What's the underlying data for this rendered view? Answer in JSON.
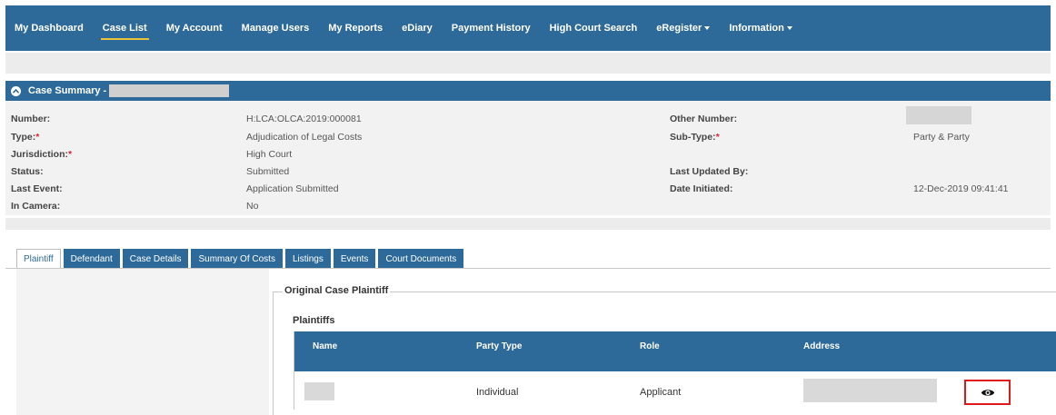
{
  "nav": {
    "items": [
      {
        "label": "My Dashboard",
        "active": false,
        "dropdown": false
      },
      {
        "label": "Case List",
        "active": true,
        "dropdown": false
      },
      {
        "label": "My Account",
        "active": false,
        "dropdown": false
      },
      {
        "label": "Manage Users",
        "active": false,
        "dropdown": false
      },
      {
        "label": "My Reports",
        "active": false,
        "dropdown": false
      },
      {
        "label": "eDiary",
        "active": false,
        "dropdown": false
      },
      {
        "label": "Payment History",
        "active": false,
        "dropdown": false
      },
      {
        "label": "High Court Search",
        "active": false,
        "dropdown": false
      },
      {
        "label": "eRegister",
        "active": false,
        "dropdown": true
      },
      {
        "label": "Information",
        "active": false,
        "dropdown": true
      }
    ]
  },
  "summary": {
    "title": "Case Summary -",
    "toggle_icon": "chevron-up-icon",
    "number_label": "Number:",
    "number_value": "H:LCA:OLCA:2019:000081",
    "other_number_label": "Other Number:",
    "type_label": "Type:",
    "type_value": "Adjudication of Legal Costs",
    "subtype_label": "Sub-Type:",
    "subtype_value": "Party & Party",
    "jurisdiction_label": "Jurisdiction:",
    "jurisdiction_value": "High Court",
    "status_label": "Status:",
    "status_value": "Submitted",
    "last_updated_label": "Last Updated By:",
    "last_event_label": "Last Event:",
    "last_event_value": "Application Submitted",
    "date_initiated_label": "Date Initiated:",
    "date_initiated_value": "12-Dec-2019 09:41:41",
    "in_camera_label": "In Camera:",
    "in_camera_value": "No",
    "required_mark": "*"
  },
  "tabs": [
    {
      "label": "Plaintiff",
      "active": true
    },
    {
      "label": "Defendant",
      "active": false
    },
    {
      "label": "Case Details",
      "active": false
    },
    {
      "label": "Summary Of Costs",
      "active": false
    },
    {
      "label": "Listings",
      "active": false
    },
    {
      "label": "Events",
      "active": false
    },
    {
      "label": "Court Documents",
      "active": false
    }
  ],
  "plaintiff": {
    "fieldset_title": "Original Case Plaintiff",
    "section_title": "Plaintiffs",
    "columns": [
      "Name",
      "Party Type",
      "Role",
      "Address"
    ],
    "rows": [
      {
        "party_type": "Individual",
        "role": "Applicant",
        "action_icon": "eye-icon"
      }
    ]
  },
  "colors": {
    "primary": "#2d6a9a",
    "active_underline": "#e8c23a",
    "highlight_border": "#e01a1a",
    "required": "#dd2233"
  }
}
